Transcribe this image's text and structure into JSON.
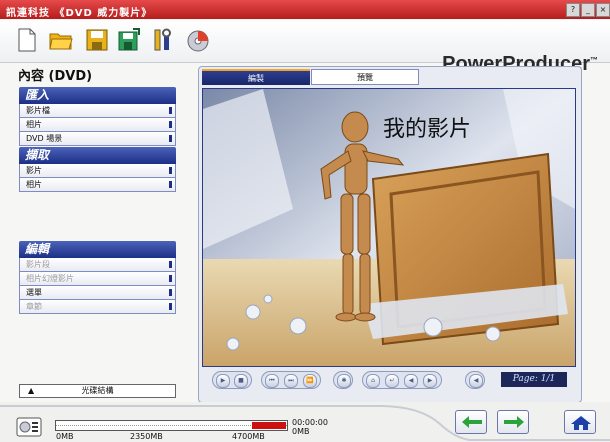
{
  "window": {
    "title": "訊連科技 《DVD 威力製片》",
    "buttons": [
      "?",
      "_",
      "×"
    ]
  },
  "toolbar": {
    "brand": "PowerProducer",
    "brand_mark": "™",
    "icons": [
      "new-icon",
      "open-folder-icon",
      "save-icon",
      "save-as-icon",
      "tools-icon",
      "burn-disc-icon"
    ]
  },
  "sidebar": {
    "title": "內容 (DVD)",
    "import": {
      "label": "匯入",
      "items": [
        "影片檔",
        "相片",
        "DVD 場景"
      ]
    },
    "capture": {
      "label": "擷取",
      "items": [
        "影片",
        "相片"
      ]
    },
    "edit": {
      "label": "編輯",
      "items": [
        "影片段",
        "相片幻燈影片",
        "選單",
        "章節"
      ],
      "disabled": [
        true,
        true,
        false,
        true
      ]
    },
    "disc_structure": "光碟結構"
  },
  "tabs": {
    "edit": "編製",
    "preview": "預覽"
  },
  "preview": {
    "menu_title": "我的影片"
  },
  "player": {
    "page": "Page: 1/1"
  },
  "capacity": {
    "time": "00:00:00",
    "size": "0MB",
    "ticks": [
      "0MB",
      "2350MB",
      "4700MB"
    ],
    "used_fraction": 0.0
  },
  "colors": {
    "title_bar": "#c62626",
    "accent": "#1c2f86",
    "warn": "#cc1010"
  }
}
